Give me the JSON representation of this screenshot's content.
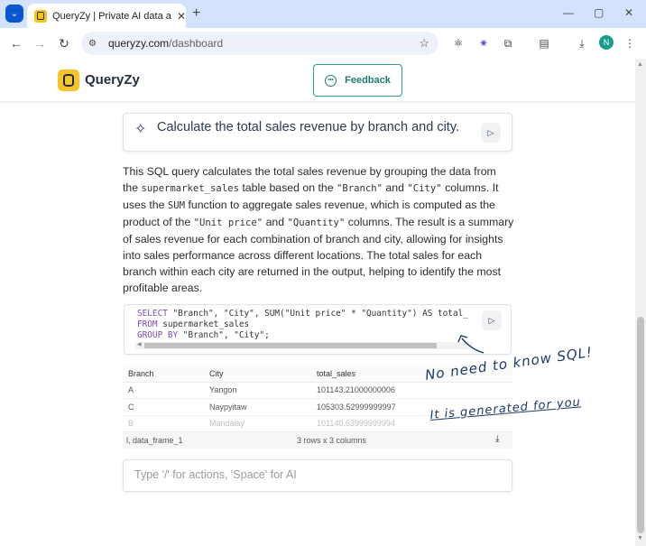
{
  "browser": {
    "tab_title": "QueryZy | Private AI data analy",
    "url_domain": "queryzy.com",
    "url_path": "/dashboard",
    "profile_initial": "N"
  },
  "header": {
    "brand": "QueryZy",
    "feedback_label": "Feedback"
  },
  "prompt": {
    "text": "Calculate the total sales revenue by branch and city."
  },
  "explanation": {
    "p1": "This SQL query calculates the total sales revenue by grouping the data from the ",
    "table": "supermarket_sales",
    "p2": " table based on the ",
    "col_branch": "\"Branch\"",
    "p3": " and ",
    "col_city": "\"City\"",
    "p4": " columns. It uses the ",
    "fn_sum": "SUM",
    "p5": " function to aggregate sales revenue, which is computed as the product of the ",
    "col_unit": "\"Unit price\"",
    "p6": " and ",
    "col_qty": "\"Quantity\"",
    "p7": " columns. The result is a summary of sales revenue for each combination of branch and city, allowing for insights into sales performance across different locations. The total sales for each branch within each city are returned in the output, helping to identify the most profitable areas."
  },
  "sql": {
    "l1_kw": "SELECT",
    "l1_rest": " \"Branch\", \"City\", SUM(\"Unit price\" * \"Quantity\") AS total_",
    "l2_kw": "FROM",
    "l2_rest": " supermarket_sales",
    "l3_kw": "GROUP BY",
    "l3_rest": " \"Branch\", \"City\";"
  },
  "results": {
    "columns": [
      "Branch",
      "City",
      "total_sales"
    ],
    "rows": [
      [
        "A",
        "Yangon",
        "101143.21000000006"
      ],
      [
        "C",
        "Naypyitaw",
        "105303.52999999997"
      ],
      [
        "B",
        "Mandalay",
        "101140.63999999994"
      ]
    ],
    "frame_name": "l, data_frame_1",
    "shape": "3 rows x 3 columns"
  },
  "input": {
    "placeholder": "Type '/' for actions, 'Space' for AI"
  },
  "annotations": {
    "line1": "No need to know SQL!",
    "line2": "It is generated for you"
  },
  "colors": {
    "accent": "#2a9d8f",
    "brand_yellow": "#f6c42b",
    "annotation_ink": "#1c3a63"
  }
}
